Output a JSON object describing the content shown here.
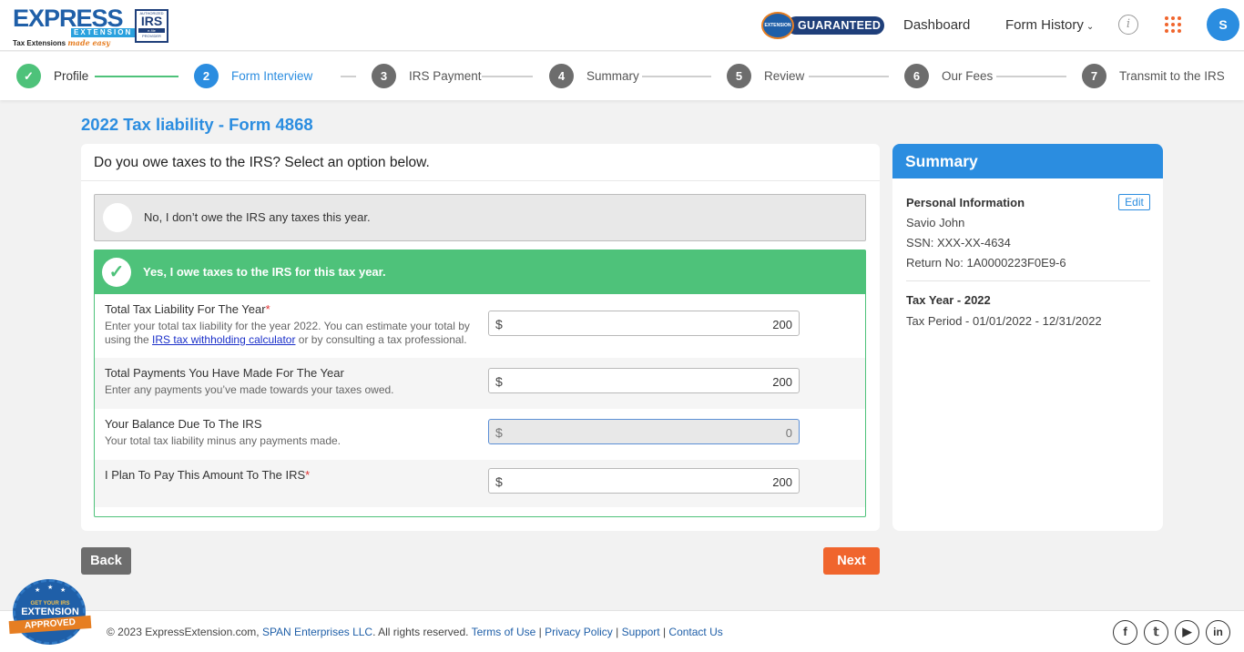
{
  "header": {
    "logo_word": "EXPRESS",
    "logo_sub": "EXTENSION",
    "logo_tag": "Tax Extensions",
    "logo_tag2": "made easy",
    "irs_top": "AUTHORIZED",
    "irs_main": "IRS",
    "irs_mid": "e-file",
    "irs_bottom": "PROVIDER",
    "guarantee_seal": "EXTENSION",
    "guarantee_label": "GUARANTEED",
    "nav_dashboard": "Dashboard",
    "nav_form_history": "Form History",
    "avatar_initial": "S"
  },
  "stepper": {
    "steps": [
      {
        "num": "✓",
        "label": "Profile",
        "state": "done"
      },
      {
        "num": "2",
        "label": "Form Interview",
        "state": "active"
      },
      {
        "num": "3",
        "label": "IRS Payment",
        "state": "todo"
      },
      {
        "num": "4",
        "label": "Summary",
        "state": "todo"
      },
      {
        "num": "5",
        "label": "Review",
        "state": "todo"
      },
      {
        "num": "6",
        "label": "Our Fees",
        "state": "todo"
      },
      {
        "num": "7",
        "label": "Transmit to the IRS",
        "state": "todo"
      }
    ]
  },
  "page_title": "2022 Tax liability - Form 4868",
  "question": "Do you owe taxes to the IRS? Select an option below.",
  "option_no": "No, I don’t owe the IRS any taxes this year.",
  "option_yes": "Yes, I owe taxes to the IRS for this tax year.",
  "fields": {
    "liability": {
      "title": "Total Tax Liability For The Year",
      "req": "*",
      "help_pre": "Enter your total tax liability for the year 2022. You can estimate your total by using the ",
      "help_link": "IRS tax withholding calculator",
      "help_post": " or by consulting a tax professional.",
      "currency": "$",
      "value": "200"
    },
    "payments": {
      "title": "Total Payments You Have Made For The Year",
      "help": "Enter any payments you’ve made towards your taxes owed.",
      "currency": "$",
      "value": "200"
    },
    "balance": {
      "title": "Your Balance Due To The IRS",
      "help": "Your total tax liability minus any payments made.",
      "currency": "$",
      "value": "0"
    },
    "plan": {
      "title": "I Plan To Pay This Amount To The IRS",
      "req": "*",
      "currency": "$",
      "value": "200"
    }
  },
  "summary": {
    "title": "Summary",
    "personal_heading": "Personal Information",
    "edit_label": "Edit",
    "name": "Savio John",
    "ssn": "SSN: XXX-XX-4634",
    "return_no": "Return No: 1A0000223F0E9-6",
    "tax_year": "Tax Year - 2022",
    "tax_period": "Tax Period - 01/01/2022 - 12/31/2022"
  },
  "buttons": {
    "back": "Back",
    "next": "Next"
  },
  "footer": {
    "copyright": "© 2023 ExpressExtension.com, ",
    "company": "SPAN Enterprises LLC",
    "rights": ". All rights reserved. ",
    "terms": "Terms of Use",
    "privacy": "Privacy Policy",
    "support": "Support",
    "contact": "Contact Us",
    "sep": " | ",
    "badge_line1": "GET YOUR IRS",
    "badge_line2": "EXTENSION",
    "badge_ribbon": "APPROVED"
  },
  "colors": {
    "brand_blue": "#2b8de0",
    "success_green": "#4ec27a",
    "cta_orange": "#f0652d"
  },
  "icons": [
    "info-icon",
    "apps-grid-icon",
    "check-icon",
    "facebook-icon",
    "twitter-icon",
    "youtube-icon",
    "linkedin-icon"
  ]
}
